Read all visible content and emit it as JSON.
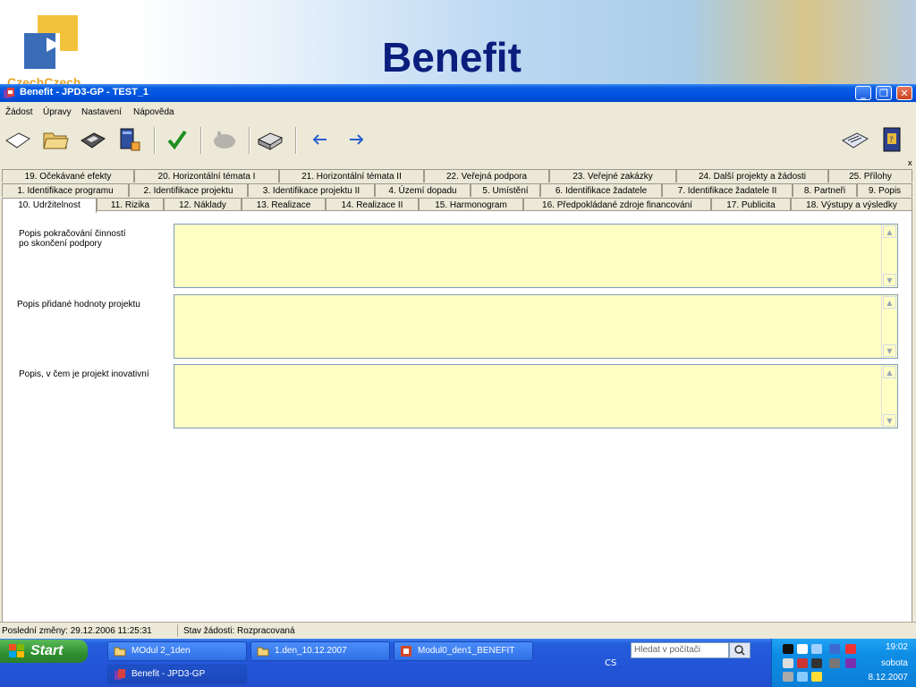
{
  "banner": {
    "title": "Benefit",
    "logo_text": "CzechCzech"
  },
  "window": {
    "title": "Benefit - JPD3-GP - TEST_1",
    "controls": {
      "minimize": "_",
      "restore": "❐",
      "close": "✕"
    }
  },
  "menu": [
    "Žádost",
    "Úpravy",
    "Nastavení",
    "Nápověda"
  ],
  "tabs": {
    "row1": [
      "19. Očekávané efekty",
      "20. Horizontální témata I",
      "21. Horizontální témata II",
      "22. Veřejná podpora",
      "23. Veřejné zakázky",
      "24. Další projekty a žádosti",
      "25. Přílohy"
    ],
    "row2": [
      "1. Identifikace programu",
      "2. Identifikace projektu",
      "3. Identifikace projektu II",
      "4. Území dopadu",
      "5. Umístění",
      "6. Identifikace žadatele",
      "7. Identifikace žadatele II",
      "8. Partneři",
      "9. Popis"
    ],
    "row3": [
      "10. Udržitelnost",
      "11. Rizika",
      "12. Náklady",
      "13. Realizace",
      "14. Realizace II",
      "15. Harmonogram",
      "16. Předpokládané zdroje financování",
      "17. Publicita",
      "18. Výstupy a výsledky"
    ],
    "active": "10. Udržitelnost"
  },
  "fields": [
    {
      "label_line1": "Popis pokračování činností",
      "label_line2": "po skončení podpory",
      "value": ""
    },
    {
      "label_line1": "Popis přidané hodnoty projektu",
      "label_line2": "",
      "value": ""
    },
    {
      "label_line1": "Popis, v čem je projekt inovativní",
      "label_line2": "",
      "value": ""
    }
  ],
  "panel_close": "x",
  "status": {
    "last_change": "Poslední změny: 29.12.2006 11:25:31",
    "state": "Stav žádosti: Rozpracovaná"
  },
  "taskbar": {
    "start": "Start",
    "tasks": [
      "MOdul 2_1den",
      "1.den_10.12.2007",
      "Modul0_den1_BENEFIT",
      "Benefit - JPD3-GP"
    ],
    "lang": "CS",
    "search_placeholder": "Hledat v počítači",
    "clock": {
      "time": "19:02",
      "day": "sobota",
      "date": "8.12.2007"
    }
  },
  "colors": {
    "field_bg": "#ffffc4",
    "title_bar": "#0054e3",
    "banner_title": "#0b1e7d"
  },
  "toolbar_icons": [
    "new-document-icon",
    "open-folder-icon",
    "save-disk-icon",
    "server-send-icon",
    "check-icon",
    "hand-icon",
    "print-icon",
    "arrow-left-icon",
    "arrow-right-icon",
    "mail-icon",
    "help-book-icon"
  ]
}
